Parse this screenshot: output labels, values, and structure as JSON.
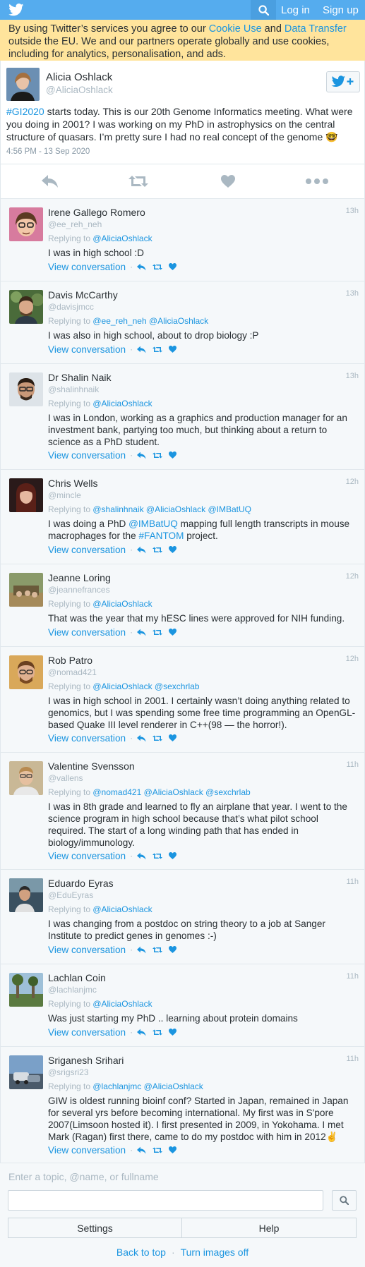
{
  "colors": {
    "brand": "#55acee",
    "link": "#1b95e0",
    "banner": "#ffe49c",
    "muted": "#aab8c2"
  },
  "topbar": {
    "logo_icon": "twitter-bird-icon",
    "search_icon": "search-icon",
    "login_label": "Log in",
    "signup_label": "Sign up"
  },
  "banner": {
    "prefix": "By using Twitter’s services you agree to our ",
    "cookie_link": "Cookie Use",
    "middle": " and ",
    "transfer_link": "Data Transfer",
    "suffix": " outside the EU. We and our partners operate globally and use cookies, including for analytics, personalisation, and ads."
  },
  "main_tweet": {
    "name": "Alicia Oshlack",
    "handle": "@AliciaOshlack",
    "hashtag": "#GI2020",
    "text": " starts today. This is our 20th Genome Informatics meeting. What were you doing in 2001? I was working on my PhD in astrophysics on the central structure of quasars. I’m pretty sure I had no real concept of the genome 🤓",
    "timestamp": "4:56 PM - 13 Sep 2020"
  },
  "replies": [
    {
      "name": "Irene Gallego Romero",
      "handle": "@ee_reh_neh",
      "time": "13h",
      "replying_prefix": "Replying to ",
      "replying_to": "@AliciaOshlack",
      "text": "I was in high school :D",
      "view": "View conversation"
    },
    {
      "name": "Davis McCarthy",
      "handle": "@davisjmcc",
      "time": "13h",
      "replying_prefix": "Replying to ",
      "replying_to": "@ee_reh_neh @AliciaOshlack",
      "text": "I was also in high school, about to drop biology :P",
      "view": "View conversation"
    },
    {
      "name": "Dr Shalin Naik",
      "handle": "@shalinhnaik",
      "time": "13h",
      "replying_prefix": "Replying to ",
      "replying_to": "@AliciaOshlack",
      "text": "I was in London, working as a graphics and production manager for an investment bank, partying too much, but thinking about a return to science as a PhD student.",
      "view": "View conversation"
    },
    {
      "name": "Chris Wells",
      "handle": "@mincle",
      "time": "12h",
      "replying_prefix": "Replying to ",
      "replying_to": "@shalinhnaik @AliciaOshlack @IMBatUQ",
      "text_a": "I was doing a PhD ",
      "text_mention": "@IMBatUQ",
      "text_b": " mapping full length transcripts in mouse macrophages for the ",
      "text_tag": "#FANTOM",
      "text_c": " project.",
      "view": "View conversation"
    },
    {
      "name": "Jeanne Loring",
      "handle": "@jeannefrances",
      "time": "12h",
      "replying_prefix": "Replying to ",
      "replying_to": "@AliciaOshlack",
      "text": "That was the year that my hESC lines were approved for NIH funding.",
      "view": "View conversation"
    },
    {
      "name": "Rob Patro",
      "handle": "@nomad421",
      "time": "12h",
      "replying_prefix": "Replying to ",
      "replying_to": "@AliciaOshlack @sexchrlab",
      "text": "I was in high school in 2001. I certainly wasn’t doing anything related to genomics, but I was spending some free time programming an OpenGL-based Quake III level renderer in C++(98 — the horror!).",
      "view": "View conversation"
    },
    {
      "name": "Valentine Svensson",
      "handle": "@vallens",
      "time": "11h",
      "replying_prefix": "Replying to ",
      "replying_to": "@nomad421 @AliciaOshlack @sexchrlab",
      "text": "I was in 8th grade and learned to fly an airplane that year. I went to the science program in high school because that’s what pilot school required. The start of a long winding path that has ended in biology/immunology.",
      "view": "View conversation"
    },
    {
      "name": "Eduardo Eyras",
      "handle": "@EduEyras",
      "time": "11h",
      "replying_prefix": "Replying to ",
      "replying_to": "@AliciaOshlack",
      "text": "I was changing from a postdoc on string theory to a job at Sanger Institute to predict genes in genomes :-)",
      "view": "View conversation"
    },
    {
      "name": "Lachlan Coin",
      "handle": "@lachlanjmc",
      "time": "11h",
      "replying_prefix": "Replying to ",
      "replying_to": "@AliciaOshlack",
      "text": "Was just starting my PhD .. learning about protein domains",
      "view": "View conversation"
    },
    {
      "name": "Sriganesh Srihari",
      "handle": "@srigsri23",
      "time": "11h",
      "replying_prefix": "Replying to ",
      "replying_to": "@lachlanjmc @AliciaOshlack",
      "text": "GIW is oldest running bioinf conf? Started in Japan, remained in Japan for several yrs before becoming international. My first was in S'pore 2007(Limsoon hosted it). I first presented in 2009, in Yokohama. I met Mark (Ragan) first there, came to do my postdoc with him in 2012✌️",
      "view": "View conversation"
    }
  ],
  "footer": {
    "search_placeholder": "Enter a topic, @name, or fullname",
    "settings_label": "Settings",
    "help_label": "Help",
    "back_to_top": "Back to top",
    "dot": "·",
    "turn_images_off": "Turn images off"
  }
}
